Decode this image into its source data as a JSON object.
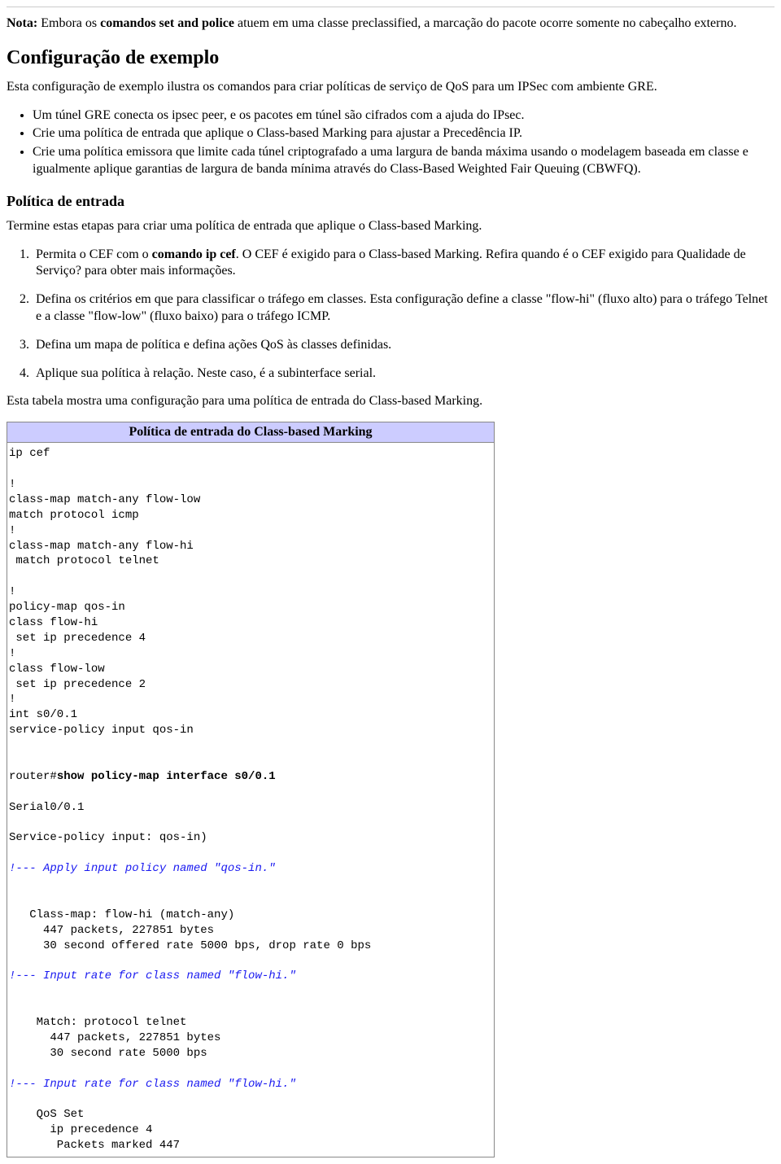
{
  "nota": {
    "label": "Nota:",
    "t1": " Embora os ",
    "b1": "comandos set and police",
    "t2": " atuem em uma classe preclassified, a marcação do pacote ocorre somente no cabeçalho externo."
  },
  "h2_config": "Configuração de exemplo",
  "p_intro": "Esta configuração de exemplo ilustra os comandos para criar políticas de serviço de QoS para um IPSec com ambiente GRE.",
  "ul1": [
    "Um túnel GRE conecta os ipsec peer, e os pacotes em túnel são cifrados com a ajuda do IPsec.",
    "Crie uma política de entrada que aplique o Class-based Marking para ajustar a Precedência IP.",
    "Crie uma política emissora que limite cada túnel criptografado a uma largura de banda máxima usando o modelagem baseada em classe e igualmente aplique garantias de largura de banda mínima através do Class-Based Weighted Fair Queuing (CBWFQ)."
  ],
  "h3_entrada": "Política de entrada",
  "p_entrada": "Termine estas etapas para criar uma política de entrada que aplique o Class-based Marking.",
  "ol1": {
    "i1_t1": "Permita o CEF com o ",
    "i1_b1": "comando ip cef",
    "i1_t2": ". O CEF é exigido para o Class-based Marking. Refira quando é o CEF exigido para Qualidade de Serviço? para obter mais informações.",
    "i2": "Defina os critérios em que para classificar o tráfego em classes. Esta configuração define a classe \"flow-hi\" (fluxo alto) para o tráfego Telnet e a classe \"flow-low\" (fluxo baixo) para o tráfego ICMP.",
    "i3": "Defina um mapa de política e defina ações QoS às classes definidas.",
    "i4": "Aplique sua política à relação. Neste caso, é a subinterface serial."
  },
  "p_tabela": "Esta tabela mostra uma configuração para uma política de entrada do Class-based Marking.",
  "table_header": "Política de entrada do Class-based Marking",
  "code": {
    "p1": "ip cef\n\n!\nclass-map match-any flow-low\nmatch protocol icmp\n!\nclass-map match-any flow-hi\n match protocol telnet\n\n!\npolicy-map qos-in\nclass flow-hi\n set ip precedence 4\n!\nclass flow-low\n set ip precedence 2\n!\nint s0/0.1\nservice-policy input qos-in\n\n\nrouter#",
    "bold1": "show policy-map interface s0/0.1",
    "p2": "\n\nSerial0/0.1\n\nService-policy input: qos-in)\n\n",
    "c1": "!--- Apply input policy named \"qos-in.\"",
    "p3": "\n\n\n   Class-map: flow-hi (match-any)\n     447 packets, 227851 bytes\n     30 second offered rate 5000 bps, drop rate 0 bps\n\n",
    "c2": "!--- Input rate for class named \"flow-hi.\"",
    "p4": "\n\n\n    Match: protocol telnet\n      447 packets, 227851 bytes\n      30 second rate 5000 bps\n\n",
    "c3": "!--- Input rate for class named \"flow-hi.\"",
    "p5": "\n\n    QoS Set\n      ip precedence 4\n       Packets marked 447"
  }
}
